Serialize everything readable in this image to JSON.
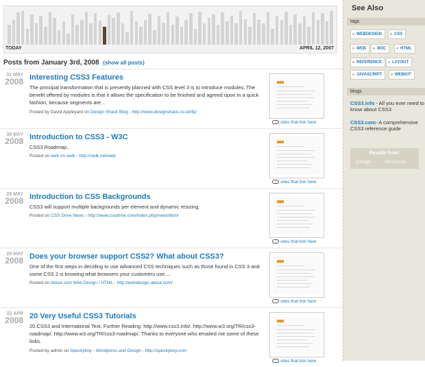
{
  "timeline": {
    "left_label": "TODAY",
    "right_label": "APRIL 12, 2007",
    "bar_levels": [
      0.55,
      0.7,
      0.9,
      0.95,
      0.45,
      0.85,
      0.6,
      0.8,
      0.5,
      0.9,
      0.75,
      0.4,
      0.65,
      0.3,
      0.85,
      0.55,
      0.7,
      0.92,
      0.6,
      0.88,
      0.68,
      0.5,
      0.82,
      0.75,
      0.9,
      0.6,
      0.35,
      0.95,
      0.65,
      0.5,
      0.7,
      0.86,
      0.4,
      0.8,
      0.62,
      0.9,
      0.55,
      0.78,
      0.5,
      0.7,
      0.88,
      0.45,
      0.92,
      0.6,
      0.75,
      0.85,
      0.55,
      0.9,
      0.65,
      0.8,
      0.6,
      0.95,
      0.72,
      0.5,
      0.88,
      0.7,
      0.6,
      0.9,
      0.45,
      0.8,
      0.7,
      0.92,
      0.55,
      0.85,
      0.6,
      0.78,
      0.5,
      0.9,
      0.7,
      0.88,
      0.65,
      0.95
    ],
    "active_index": 21
  },
  "heading": {
    "title": "Posts from January 3rd, 2008",
    "show_all": "(show all posts)"
  },
  "posts": [
    {
      "day": "31 MAY",
      "year": "2008",
      "title": "Interesting CSS3 Features",
      "excerpt": "The principal transformation that is presently planned with CSS level 3 is to introduce modules. The benefit offered by modules is that it allows the specification to be finished and agreed upon in a quick fashion, because segments are...",
      "meta_prefix": "Posted by David Appleyard on",
      "meta_link": "Design Shack Blog - http://www.designshack.co.uk/fp/",
      "sites": "sites that link here"
    },
    {
      "day": "30 MAY",
      "year": "2008",
      "title": "Introduction to CSS3 - W3C",
      "excerpt": "CSS3 Roadmap..",
      "meta_prefix": "Posted on",
      "meta_link": "web on swik - http://swik.net/web",
      "sites": "sites that link here"
    },
    {
      "day": "29 MAY",
      "year": "2008",
      "title": "Introduction to CSS Backgrounds",
      "excerpt": "CSS3 will support multiple backgrounds per element and dynamic resizing.",
      "meta_prefix": "Posted on",
      "meta_link": "CSS Drive News - http://www.cssdrive.com/index.php/news/item/",
      "sites": "sites that link here"
    },
    {
      "day": "29 MAY",
      "year": "2008",
      "title": "Does your browser support CSS2? What about CSS3?",
      "excerpt": "One of the first steps in deciding to use advanced CSS techniques such as those found in CSS 3 and some CSS 2 is knowing what browsers your customers use....",
      "meta_prefix": "Posted on",
      "meta_link": "About.com Web Design / HTML - http://webdesign.about.com/",
      "sites": "sites that link here"
    },
    {
      "day": "22 APR",
      "year": "2008",
      "title": "20 Very Useful CSS3 Tutorials",
      "excerpt": "20.CSS3 and International Text. Further Reading. http://www.css3.info/. http://www.w3.org/TR/css3-roadmap/. http://www.w3.org/TR/css3-roadmap/. Thanks to everyone who emailed me some of these links.",
      "meta_prefix": "Posted by admin on",
      "meta_link": "Speckyboy - Wordpress and Design - http://speckyboy.com",
      "sites": "sites that link here"
    }
  ],
  "sidebar": {
    "title": "See Also",
    "tags_label": "tags",
    "tags": [
      "WEBDESIGN",
      "CSS",
      "WEB",
      "W3C",
      "HTML",
      "REFERENCE",
      "LAYOUT",
      "JAVASCRIPT",
      "WEBKIT"
    ],
    "blogs_label": "blogs",
    "blogs": [
      {
        "name": "CSS3.info",
        "desc": " - All you ever need to know about CSS3"
      },
      {
        "name": "CSS3.com",
        "desc": "- A comprehensive CSS3 reference guide"
      }
    ],
    "results_label": "Results from:",
    "sources": [
      "Google",
      "del.icio.us"
    ]
  }
}
